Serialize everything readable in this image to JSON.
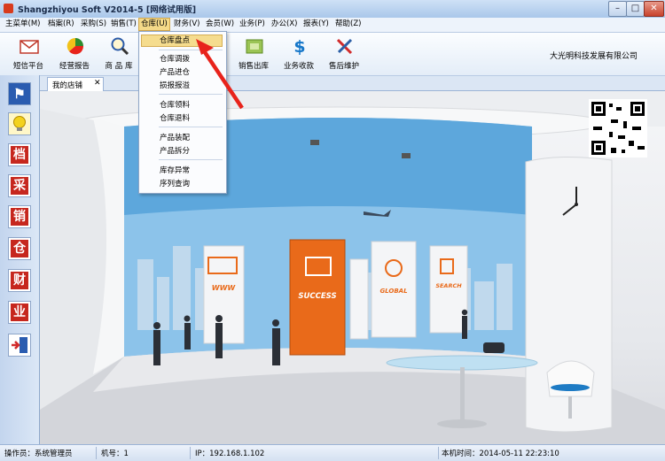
{
  "window": {
    "title": "Shangzhiyou Soft V2014-5 [网络试用版]",
    "controls": {
      "minimize": "–",
      "maximize": "□",
      "close": "✕"
    }
  },
  "menu": [
    {
      "label": "主菜单(M)"
    },
    {
      "label": "档案(R)"
    },
    {
      "label": "采购(S)"
    },
    {
      "label": "销售(T)"
    },
    {
      "label": "仓库(U)",
      "active": true
    },
    {
      "label": "财务(V)"
    },
    {
      "label": "会员(W)"
    },
    {
      "label": "业务(P)"
    },
    {
      "label": "办公(X)"
    },
    {
      "label": "报表(Y)"
    },
    {
      "label": "帮助(Z)"
    }
  ],
  "toolbar": {
    "items": [
      {
        "label": "短信平台",
        "icon": "envelope-icon"
      },
      {
        "label": "经营报告",
        "icon": "pie-chart-icon"
      },
      {
        "label": "商 品 库",
        "icon": "magnifier-icon"
      },
      {
        "label": "销售出库",
        "icon": "box-icon"
      },
      {
        "label": "业务收款",
        "icon": "dollar-icon"
      },
      {
        "label": "售后维护",
        "icon": "tools-icon"
      }
    ],
    "company": "大光明科技发展有限公司"
  },
  "dropdown": {
    "items": [
      "仓库盘点",
      "仓库调拨",
      "产品进仓",
      "损报报溢",
      "仓库领料",
      "仓库退料",
      "产品装配",
      "产品拆分",
      "库存异常",
      "序列查询"
    ],
    "highlighted": "仓库盘点"
  },
  "sidebar": {
    "items": [
      {
        "icon": "flag-icon",
        "glyph": "⚑"
      },
      {
        "icon": "lightbulb-icon",
        "glyph": ""
      },
      {
        "icon": "dang-archive-icon",
        "glyph": "档"
      },
      {
        "icon": "cai-purchase-icon",
        "glyph": "采"
      },
      {
        "icon": "xiao-sales-icon",
        "glyph": "销"
      },
      {
        "icon": "cang-warehouse-icon",
        "glyph": "仓"
      },
      {
        "icon": "cai-finance-icon",
        "glyph": "财"
      },
      {
        "icon": "ye-business-icon",
        "glyph": "业"
      },
      {
        "icon": "exit-icon",
        "glyph": ""
      }
    ]
  },
  "tab": {
    "label": "我的店铺",
    "close": "✕"
  },
  "scene": {
    "panel_labels": [
      "WWW",
      "SUCCESS",
      "GLOBAL",
      "SEARCH"
    ]
  },
  "status": {
    "operator": "操作员：系统管理员",
    "machine": "机号：1",
    "ip": "IP：192.168.1.102",
    "time": "本机时间：2014-05-11 22:23:10"
  },
  "colors": {
    "accent_red": "#e8231b",
    "orange": "#e96a1a",
    "menu_highlight": "#f4d988"
  }
}
